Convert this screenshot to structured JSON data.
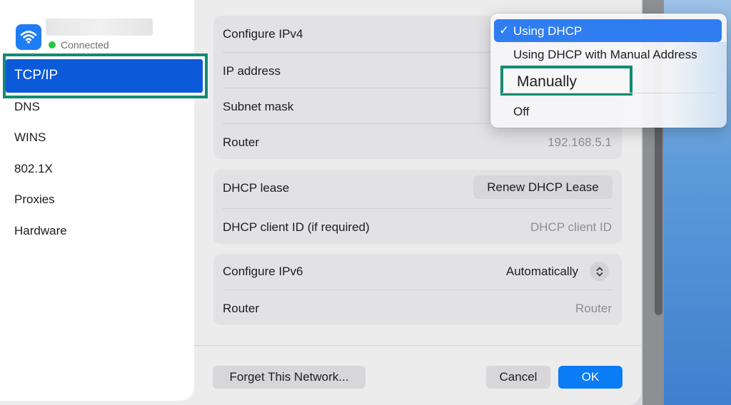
{
  "sidebar": {
    "status": "Connected",
    "items": [
      {
        "label": "TCP/IP",
        "active": true
      },
      {
        "label": "DNS"
      },
      {
        "label": "WINS"
      },
      {
        "label": "802.1X"
      },
      {
        "label": "Proxies"
      },
      {
        "label": "Hardware"
      }
    ]
  },
  "ipv4": {
    "configure_label": "Configure IPv4",
    "ip_label": "IP address",
    "subnet_label": "Subnet mask",
    "router_label": "Router",
    "router_value": "192.168.5.1"
  },
  "dhcp": {
    "lease_label": "DHCP lease",
    "renew_button": "Renew DHCP Lease",
    "client_id_label": "DHCP client ID (if required)",
    "client_id_placeholder": "DHCP client ID"
  },
  "ipv6": {
    "configure_label": "Configure IPv6",
    "configure_value": "Automatically",
    "router_label": "Router",
    "router_placeholder": "Router"
  },
  "footer": {
    "forget_button": "Forget This Network...",
    "cancel_button": "Cancel",
    "ok_button": "OK"
  },
  "menu": {
    "options": [
      {
        "label": "Using DHCP",
        "selected": true
      },
      {
        "label": "Using DHCP with Manual Address"
      },
      {
        "label": "Manually"
      },
      {
        "label": "Off"
      }
    ]
  },
  "colors": {
    "accent": "#0a7cf5",
    "sidebar_selection": "#0b5ad9",
    "highlight_border": "#138a72",
    "status_green": "#27c93f"
  }
}
